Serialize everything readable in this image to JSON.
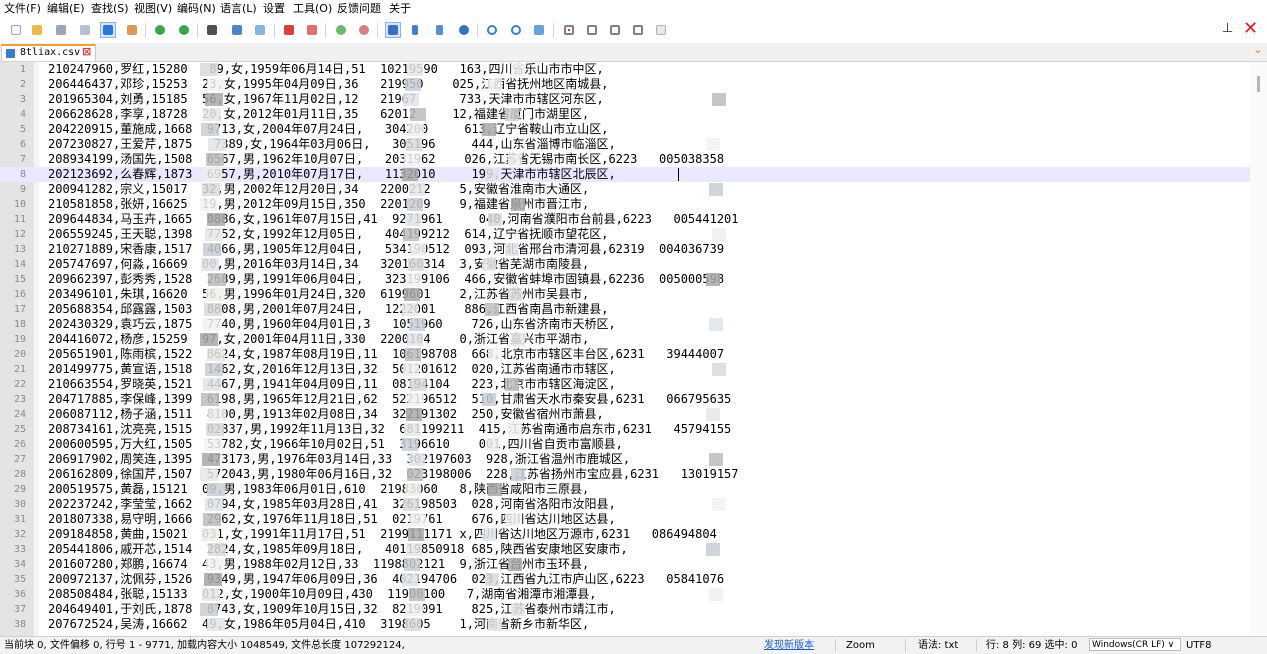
{
  "menu": [
    "文件(F)",
    "编辑(E)",
    "查找(S)",
    "视图(V)",
    "编码(N)",
    "语言(L)",
    "设置",
    "工具(O)",
    "反馈问题",
    "关于"
  ],
  "tab": {
    "label": "8tliax.csv",
    "close": "⊠"
  },
  "lines": [
    {
      "n": "1",
      "text": "210247960,罗红,15280   89,女,1959年06月14日,51  10219590   163,四川省乐山市市中区,"
    },
    {
      "n": "2",
      "text": "206446437,邓珍,15253  23,女,1995年04月09日,36   219950    025,江西省抚州地区南城县,"
    },
    {
      "n": "3",
      "text": "201965304,刘勇,15185  56,女,1967年11月02日,12   21967      733,天津市市辖区河东区,"
    },
    {
      "n": "4",
      "text": "206628628,李享,18728  20,女,2012年01月11日,35   62012     12,福建省厦门市湖里区,"
    },
    {
      "n": "5",
      "text": "204220915,董施成,1668  9713,女,2004年07月24日,   304200     613,辽宁省鞍山市立山区,"
    },
    {
      "n": "6",
      "text": "207230827,王爱芹,1875   7389,女,1964年03月06日,   305196     444,山东省淄博市临淄区,"
    },
    {
      "n": "7",
      "text": "208934199,汤国先,1508  6567,男,1962年10月07日,   2031962    026,江苏省无锡市南长区,6223   005038358"
    },
    {
      "n": "8",
      "text": "202123692,么春辉,1873  6957,男,2010年07月17日,   1132010     199,天津市市辖区北辰区,",
      "current": true
    },
    {
      "n": "9",
      "text": "200941282,宗义,15017  32,男,2002年12月20日,34   2200212    5,安徽省淮南市大通区,"
    },
    {
      "n": "10",
      "text": "210581858,张妍,16625  19,男,2012年09月15日,350  2201209    9,福建省泉州市晋江市,"
    },
    {
      "n": "11",
      "text": "209644834,马玉卉,1665  0886,女,1961年07月15日,41  9271961     040,河南省濮阳市台前县,6223   005441201"
    },
    {
      "n": "12",
      "text": "206559245,王天聪,1398  7752,女,1992年12月05日,   404199212  614,辽宁省抚顺市望花区,"
    },
    {
      "n": "13",
      "text": "210271889,宋香康,1517  4066,男,1905年12月04日,   534190512  093,河北省邢台市清河县,62319  004036739"
    },
    {
      "n": "14",
      "text": "205747697,何淼,16669  00,男,2016年03月14日,34   320160314  3,安徽省芜湖市南陵县,"
    },
    {
      "n": "15",
      "text": "209662397,彭秀秀,1528  2689,男,1991年06月04日,   323199106  466,安徽省蚌埠市固镇县,62236  005000598"
    },
    {
      "n": "16",
      "text": "203496101,朱琪,16620  56,男,1996年01月24日,320  6199601    2,江苏省苏州市吴县市,"
    },
    {
      "n": "17",
      "text": "205688354,邱露露,1503  8808,男,2001年07月24日,   1222001    886,江西省南昌市新建县,"
    },
    {
      "n": "18",
      "text": "202430329,袁巧云,1875  7740,男,1960年04月01日,3   1051960    726,山东省济南市天桥区,"
    },
    {
      "n": "19",
      "text": "204416072,杨彦,15259  97,女,2001年04月11日,330  2200104    0,浙江省嘉兴市平湖市,"
    },
    {
      "n": "20",
      "text": "205651901,陈雨槟,1522  8624,女,1987年08月19日,11  106198708  668,北京市市辖区丰台区,6231   39444007"
    },
    {
      "n": "21",
      "text": "201499775,黄宣语,1518  1462,女,2016年12月13日,32  501201612  020,江苏省南通市市辖区,"
    },
    {
      "n": "22",
      "text": "210663554,罗晓英,1521  4467,男,1941年04月09日,11  08194104   223,北京市市辖区海淀区,"
    },
    {
      "n": "23",
      "text": "204717885,李保峰,1399  6198,男,1965年12月21日,62  522196512  510,甘肃省天水市秦安县,6231   066795635"
    },
    {
      "n": "24",
      "text": "206087112,杨子涵,1511  8100,男,1913年02月08日,34  322191302  250,安徽省宿州市萧县,"
    },
    {
      "n": "25",
      "text": "208734161,沈亮亮,1515  02837,男,1992年11月13日,32  681199211  415,江苏省南通市启东市,6231   45794155"
    },
    {
      "n": "26",
      "text": "200600595,万大红,1505  53782,女,1966年10月02日,51  3196610    001,四川省自贡市富顺县,"
    },
    {
      "n": "27",
      "text": "206917902,周笑连,1395  473173,男,1976年03月14日,33  302197603  928,浙江省温州市鹿城区,"
    },
    {
      "n": "28",
      "text": "206162809,徐国芹,1507  572043,男,1980年06月16日,32  023198006  228,江苏省扬州市宝应县,6231   13019157"
    },
    {
      "n": "29",
      "text": "200519575,黄磊,15121  09,男,1983年06月01日,610  21983060   8,陕西省咸阳市三原县,"
    },
    {
      "n": "30",
      "text": "202237242,李莹莹,1662  0794,女,1985年03月28日,41  326198503  028,河南省洛阳市汝阳县,"
    },
    {
      "n": "31",
      "text": "201807338,易守明,1666  2962,女,1976年11月18日,51  0219761    676,四川省达川地区达县,"
    },
    {
      "n": "32",
      "text": "209184858,黄曲,15021  031,女,1991年11月17日,51  2199111171 x,四川省达川地区万源市,6231   086494804"
    },
    {
      "n": "33",
      "text": "205441806,戚开芯,1514  2824,女,1985年09月18日,   40119850918 685,陕西省安康地区安康市,"
    },
    {
      "n": "34",
      "text": "201607280,郑鹏,16674  43,男,1988年02月12日,33  1198802121  9,浙江省台州市玉环县,"
    },
    {
      "n": "35",
      "text": "200972137,沈佩芬,1526  9349,男,1947年06月09日,36  402194706  023,江西省九江市庐山区,6223   05841076"
    },
    {
      "n": "36",
      "text": "208508484,张聪,15133  012,女,1900年10月09日,430  11900100   7,湖南省湘潭市湘潭县,"
    },
    {
      "n": "37",
      "text": "204649401,于刘氏,1878  8743,女,1909年10月15日,32  8219091    825,江苏省泰州市靖江市,"
    },
    {
      "n": "38",
      "text": "207672524,吴涛,16662  49,女,1986年05月04日,410  3198605    1,河南省新乡市新华区,"
    }
  ],
  "status": {
    "left": "当前块 0, 文件偏移 0, 行号 1 - 9771, 加载内容大小 1048549, 文件总长度 107292124,",
    "update_link": "发现新版本",
    "zoom": "Zoom",
    "syntax": "语法: txt",
    "position": "行: 8  列: 69  选中: 0",
    "eol": "Windows(CR LF) ∨",
    "encoding": "UTF8"
  },
  "colors": {
    "current_line": "#e8e8ff",
    "link": "#1a5fd0",
    "tab_accent": "#f0a030",
    "close_red": "#d82020"
  },
  "icons": {
    "pin": "pin-icon",
    "close": "close-icon",
    "tab_list": "chevron-down-icon"
  }
}
